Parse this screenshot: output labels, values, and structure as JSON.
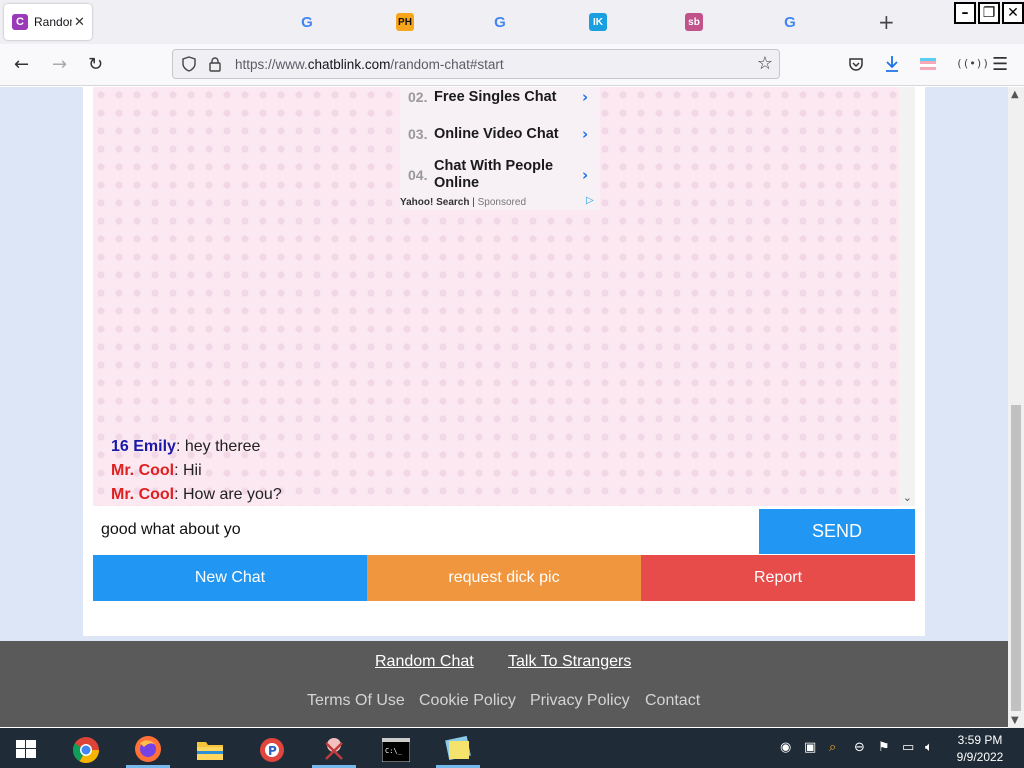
{
  "browser": {
    "active_tab": {
      "title": "Random Chat",
      "favicon": "C"
    },
    "pinned_tabs": [
      {
        "icon": "google-icon",
        "glyph": "G"
      },
      {
        "icon": "ph-icon",
        "glyph": "PH"
      },
      {
        "icon": "google-icon",
        "glyph": "G"
      },
      {
        "icon": "ik-icon",
        "glyph": "IK"
      },
      {
        "icon": "sb-icon",
        "glyph": "sb"
      },
      {
        "icon": "google-icon",
        "glyph": "G"
      }
    ],
    "url_prefix": "https://www.",
    "url_domain": "chatblink.com",
    "url_path": "/random-chat#start"
  },
  "ad": {
    "items": [
      {
        "num": "02.",
        "text": "Free Singles Chat"
      },
      {
        "num": "03.",
        "text": "Online Video Chat"
      },
      {
        "num": "04.",
        "text": "Chat With People Online"
      }
    ],
    "source": "Yahoo! Search",
    "sep": "|",
    "sponsored": "Sponsored"
  },
  "messages": [
    {
      "name": "16 Emily",
      "text": ": hey theree",
      "color": "#1a1aa6"
    },
    {
      "name": "Mr. Cool",
      "text": ": Hii",
      "color": "#e02020"
    },
    {
      "name": "Mr. Cool",
      "text": ": How are you?",
      "color": "#e02020"
    }
  ],
  "composer": {
    "value": "good what about yo",
    "send_label": "SEND"
  },
  "actions": {
    "new_chat": "New Chat",
    "request": "request dick pic",
    "report": "Report"
  },
  "footer": {
    "random_chat": "Random Chat",
    "talk_to_strangers": "Talk To Strangers",
    "terms": "Terms Of Use",
    "cookie": "Cookie Policy",
    "privacy": "Privacy Policy",
    "contact": "Contact"
  },
  "clock": {
    "time": "3:59 PM",
    "date": "9/9/2022"
  },
  "colors": {
    "new_chat": "#2196f3",
    "request": "#f0963e",
    "report": "#e84c4a",
    "send": "#2196f3"
  }
}
